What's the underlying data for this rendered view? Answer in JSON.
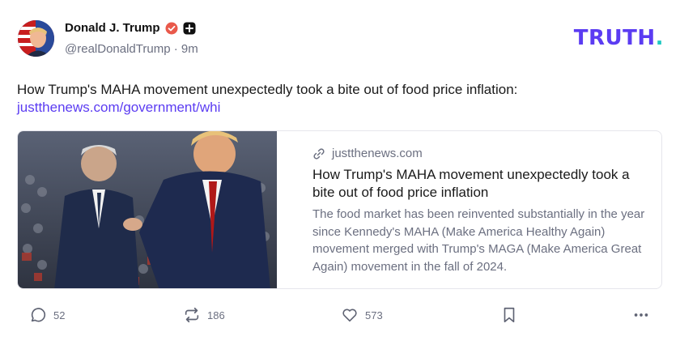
{
  "post": {
    "author": {
      "display_name": "Donald J. Trump",
      "handle": "@realDonaldTrump",
      "separator": "·",
      "time_ago": "9m",
      "verified_icon": "verified-badge-icon",
      "plus_icon": "plus-badge-icon"
    },
    "brand": {
      "logo_text": "TRUTH",
      "logo_dot": ".",
      "primary_color": "#5b3cf2",
      "accent_color": "#20c9c2"
    },
    "text": "How Trump's MAHA movement unexpectedly took a bite out of food price inflation:",
    "link_text": "justthenews.com/government/whi",
    "card": {
      "domain": "justthenews.com",
      "title": "How Trump's MAHA movement unexpectedly took a bite out of food price inflation",
      "description": "The food market has been reinvented substantially in the year since Kennedy's MAHA (Make America Healthy Again) movement merged with Trump's MAGA (Make America Great Again) movement in the fall of 2024."
    },
    "actions": {
      "replies": "52",
      "retruths": "186",
      "likes": "573"
    }
  }
}
